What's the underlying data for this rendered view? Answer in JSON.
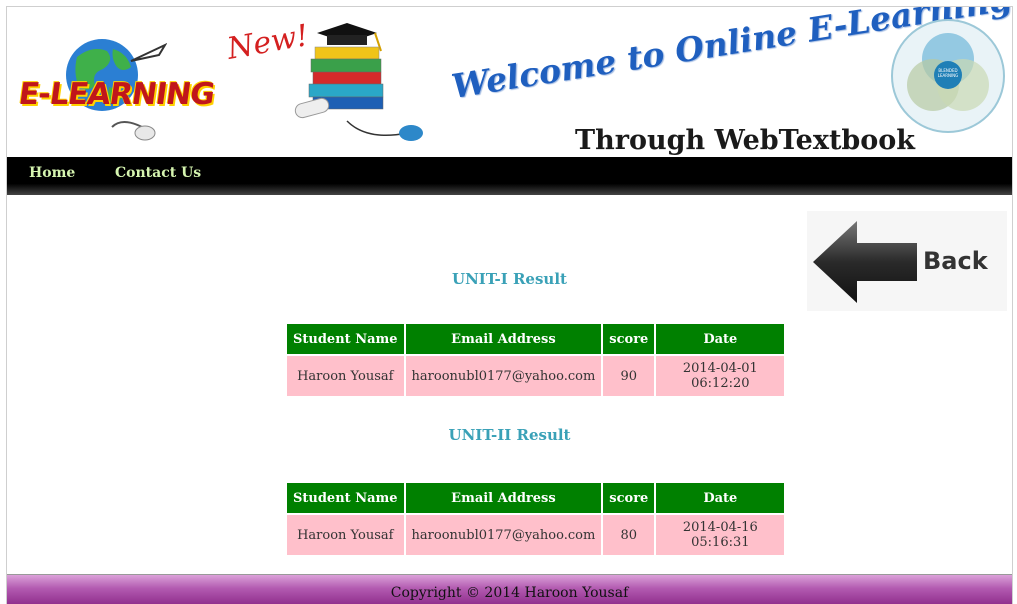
{
  "banner": {
    "logo_text": "E-LEARNING",
    "new_tag": "New!",
    "welcome": "Welcome to Online E-Learning",
    "subtitle": "Through WebTextbook",
    "blend_label": "BLENDED LEARNING"
  },
  "nav": {
    "items": [
      {
        "label": "Home"
      },
      {
        "label": "Contact Us"
      }
    ]
  },
  "back_button": {
    "label": "Back"
  },
  "results": [
    {
      "title": "UNIT-I Result",
      "columns": [
        "Student Name",
        "Email Address",
        "score",
        "Date"
      ],
      "rows": [
        [
          "Haroon Yousaf",
          "haroonubl0177@yahoo.com",
          "90",
          "2014-04-01 06:12:20"
        ]
      ]
    },
    {
      "title": "UNIT-II Result",
      "columns": [
        "Student Name",
        "Email Address",
        "score",
        "Date"
      ],
      "rows": [
        [
          "Haroon Yousaf",
          "haroonubl0177@yahoo.com",
          "80",
          "2014-04-16 05:16:31"
        ]
      ]
    }
  ],
  "footer": {
    "text": "Copyright © 2014 Haroon Yousaf"
  },
  "colors": {
    "nav_bg": "#000000",
    "nav_text": "#d6f5b0",
    "table_header": "#008000",
    "table_cell": "#ffc0cb",
    "unit_title": "#3aa1b7",
    "footer": "#b25ab0"
  }
}
